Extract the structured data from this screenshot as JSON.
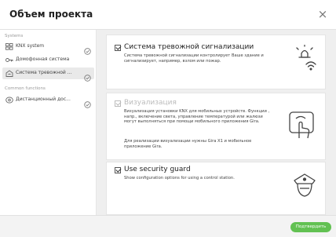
{
  "dialog": {
    "title": "Объем проекта",
    "close_glyph": "×"
  },
  "sidebar": {
    "sections": [
      {
        "label": "Systems"
      },
      {
        "label": "Common functions"
      }
    ],
    "items": [
      {
        "label": "KNX system",
        "icon": "knx-grid-icon",
        "checked": true
      },
      {
        "label": "Домофонная система",
        "icon": "key-icon",
        "checked": false
      },
      {
        "label": "Система тревожной ...",
        "icon": "house-alarm-icon",
        "checked": true,
        "active": true
      },
      {
        "label": "Дистанционный дос...",
        "icon": "remote-access-icon",
        "checked": true
      }
    ]
  },
  "content": {
    "cards": [
      {
        "title": "Система тревожной сигнализации",
        "description": "Система тревожной сигнализации контролирует Ваше здание и сигнализирует, например, взлом или пожар.",
        "checked": true,
        "disabled": false,
        "icon": "alarm-wifi-icon"
      },
      {
        "title": "Визуализация",
        "description": "Визуализация установки KNX для мобильных устройств. Функции , напр., включение света, управление температурой или жалюзи могут выполняться при помощи мобильного приложения Gira.",
        "description2": "Для реализации визуализации нужны Gira X1 и мобильное приложение Gira.",
        "checked": true,
        "disabled": true,
        "icon": "touch-tablet-icon"
      },
      {
        "title": "Use security guard",
        "description": "Show configuration options for using a control station.",
        "checked": true,
        "disabled": false,
        "icon": "security-guard-icon"
      }
    ]
  },
  "footer": {
    "confirm_label": "Подтвердить"
  },
  "colors": {
    "accent": "#62c152",
    "sidebar_active": "#e9e9e9",
    "content_bg": "#efefef"
  }
}
